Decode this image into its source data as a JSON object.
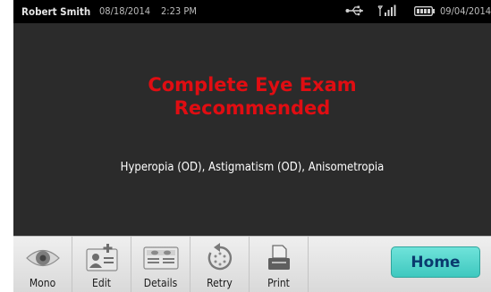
{
  "status_bar": {
    "user": "Robert Smith",
    "date": "08/18/2014",
    "time": "2:23 PM",
    "right_date": "09/04/2014",
    "icons": [
      "usb-icon",
      "signal-icon",
      "battery-icon"
    ]
  },
  "result": {
    "headline_line1": "Complete Eye Exam",
    "headline_line2": "Recommended",
    "conditions": "Hyperopia (OD),  Astigmatism (OD),  Anisometropia",
    "headline_color": "#e00d12"
  },
  "toolbar": {
    "items": [
      {
        "label": "Mono",
        "icon": "eye-icon"
      },
      {
        "label": "Edit",
        "icon": "edit-patient-icon"
      },
      {
        "label": "Details",
        "icon": "details-icon"
      },
      {
        "label": "Retry",
        "icon": "retry-icon"
      },
      {
        "label": "Print",
        "icon": "print-icon"
      }
    ],
    "home_label": "Home",
    "home_color": "#4fd3ca"
  }
}
